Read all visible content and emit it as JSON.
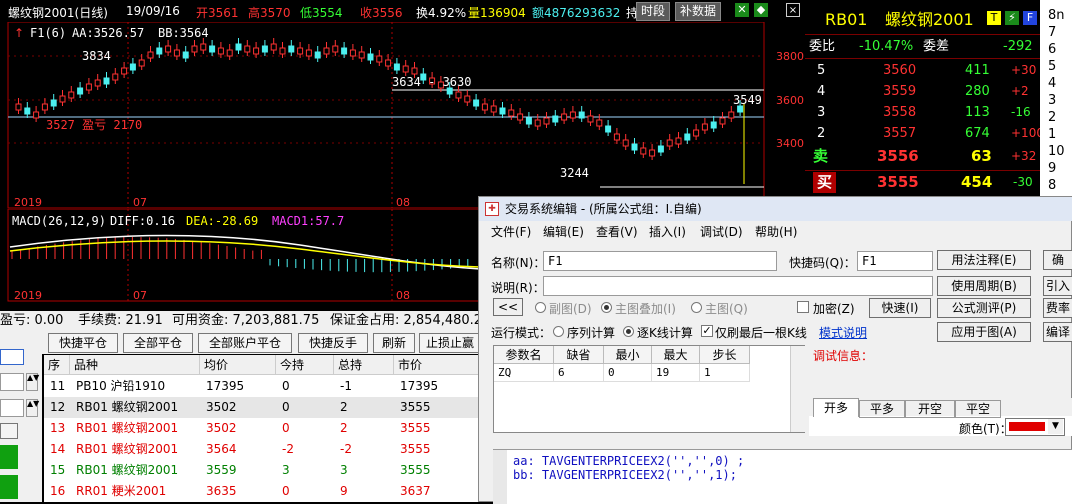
{
  "chart_header": {
    "symbol": "螺纹钢2001(日线)",
    "date": "19/09/16",
    "open": "开3561",
    "high": "高3570",
    "low": "低3554",
    "close": "收3556",
    "turnover": "换4.92%",
    "volume": "量136904",
    "amount": "额4876293632",
    "hold": "持",
    "btn_period": "时段",
    "btn_supplement": "补数据",
    "line2_f": "F1(6)",
    "line2_aa": "AA:3526.57",
    "line2_bb": "BB:3564"
  },
  "price_panel": {
    "axis_labels": [
      "3800",
      "3600",
      "3400"
    ],
    "annotations": {
      "high": "3834",
      "range": "3634 - 3630",
      "recent_high": "3549",
      "low": "3244",
      "left_note": "3527 盈亏 2170"
    },
    "x_labels": [
      "2019",
      "07",
      "08"
    ]
  },
  "macd": {
    "label": "MACD(26,12,9)",
    "diff": "DIFF:0.16",
    "dea": "DEA:-28.69",
    "macd": "MACD1:57.7",
    "x_labels": [
      "2019",
      "07",
      "08"
    ]
  },
  "order_book": {
    "code": "RB01",
    "name": "螺纹钢2001",
    "wei_bi_label": "委比",
    "wei_bi": "-10.47%",
    "wei_cha_label": "委差",
    "wei_cha": "-292",
    "asks": [
      {
        "level": "5",
        "price": "3560",
        "vol": "411",
        "chg": "+30"
      },
      {
        "level": "4",
        "price": "3559",
        "vol": "280",
        "chg": "+2"
      },
      {
        "level": "3",
        "price": "3558",
        "vol": "113",
        "chg": "-16"
      },
      {
        "level": "2",
        "price": "3557",
        "vol": "674",
        "chg": "+100"
      }
    ],
    "sell_label": "卖",
    "sell_price": "3556",
    "sell_vol": "63",
    "sell_chg": "+32",
    "buy_label": "买",
    "buy_price": "3555",
    "buy_vol": "454",
    "buy_chg": "-30"
  },
  "side_strip": [
    "8n",
    "7",
    "6",
    "5",
    "4",
    "3",
    "2",
    "1",
    "10",
    "9",
    "8"
  ],
  "account": {
    "pnl": "盈亏: 0.00",
    "fee": "手续费: 21.91",
    "funds": "可用资金: 7,203,881.75",
    "margin": "保证金占用: 2,854,480.2"
  },
  "toolbar": [
    "快捷平仓",
    "全部平仓",
    "全部账户平仓",
    "快捷反手",
    "刷新",
    "止损止赢"
  ],
  "positions": {
    "headers": [
      "序",
      "品种",
      "均价",
      "今持",
      "总持",
      "市价"
    ],
    "rows": [
      {
        "no": "11",
        "name": "PB10 沪铅1910",
        "avg": "17395",
        "today": "0",
        "total": "-1",
        "mkt": "17395",
        "color": "#000"
      },
      {
        "no": "12",
        "name": "RB01 螺纹钢2001",
        "avg": "3502",
        "today": "0",
        "total": "2",
        "mkt": "3555",
        "color": "#000"
      },
      {
        "no": "13",
        "name": "RB01 螺纹钢2001",
        "avg": "3502",
        "today": "0",
        "total": "2",
        "mkt": "3555",
        "color": "#e00000"
      },
      {
        "no": "14",
        "name": "RB01 螺纹钢2001",
        "avg": "3564",
        "today": "-2",
        "total": "-2",
        "mkt": "3555",
        "color": "#e00000"
      },
      {
        "no": "15",
        "name": "RB01 螺纹钢2001",
        "avg": "3559",
        "today": "3",
        "total": "3",
        "mkt": "3555",
        "color": "#008000"
      },
      {
        "no": "16",
        "name": "RR01 粳米2001",
        "avg": "3635",
        "today": "0",
        "total": "9",
        "mkt": "3637",
        "color": "#e00000"
      }
    ]
  },
  "dialog": {
    "title": "交易系统编辑 - (所属公式组：I.自编)",
    "menu": [
      "文件(F)",
      "编辑(E)",
      "查看(V)",
      "插入(I)",
      "调试(D)",
      "帮助(H)"
    ],
    "name_label": "名称(N)：",
    "name_value": "F1",
    "shortcut_label": "快捷码(Q)：",
    "shortcut_value": "F1",
    "desc_label": "说明(R)：",
    "desc_value": "",
    "collapse": "<<",
    "chart_opts": [
      "副图(D)",
      "主图叠加(I)",
      "主图(Q)"
    ],
    "encrypt": "加密(Z)",
    "fast": "快速(I)",
    "run_mode_label": "运行模式：",
    "run_opts": [
      "序列计算",
      "逐K线计算"
    ],
    "only_last": "仅刷最后一根K线",
    "mode_link": "模式说明",
    "param_headers": [
      "参数名",
      "缺省",
      "最小",
      "最大",
      "步长"
    ],
    "params": [
      {
        "name": "ZQ",
        "default": "6",
        "min": "0",
        "max": "19",
        "step": "1"
      }
    ],
    "debug_label": "调试信息：",
    "tabs": [
      "开多",
      "平多",
      "开空",
      "平空"
    ],
    "color_label": "颜色(T)：",
    "buttons": [
      "用法注释(E)",
      "使用周期(B)",
      "公式测评(P)",
      "应用于图(A)"
    ],
    "right_buttons": [
      "确",
      "引入",
      "费率",
      "编译"
    ],
    "code_lines": [
      "aa: TAVGENTERPRICEEX2('','',0) ;",
      "bb: TAVGENTERPRICEEX2('','',1);"
    ]
  }
}
